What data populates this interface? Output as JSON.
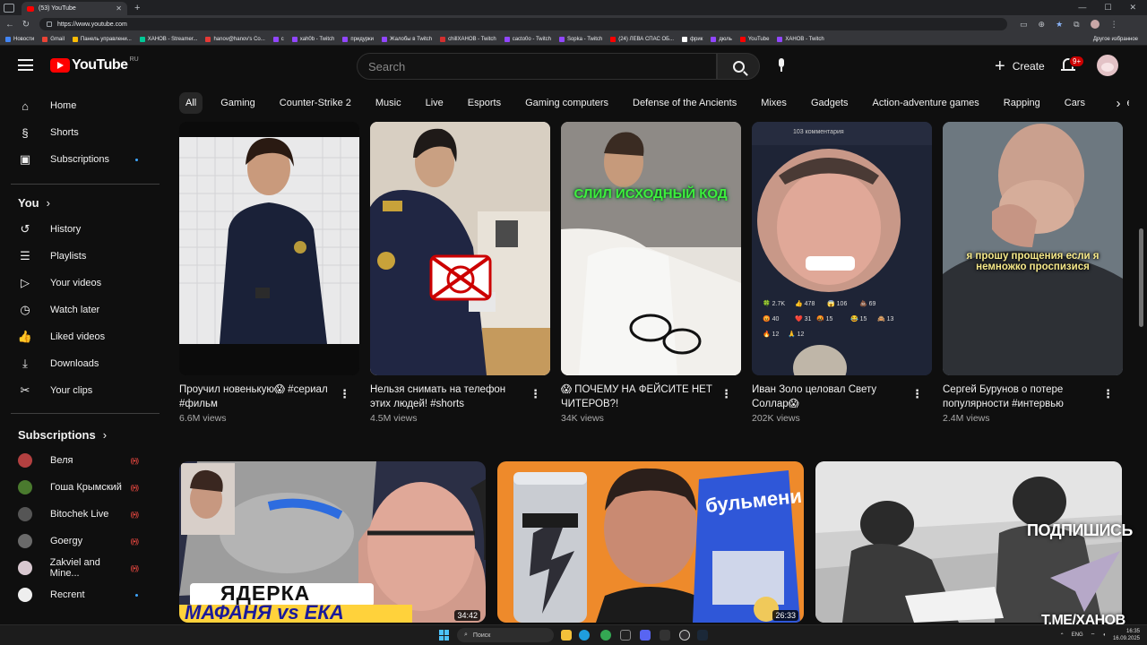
{
  "browser": {
    "tab_title": "(53) YouTube",
    "url": "https://www.youtube.com",
    "bookmarks": [
      {
        "label": "Новости",
        "color": "#4285f4"
      },
      {
        "label": "Gmail",
        "color": "#ea4335"
      },
      {
        "label": "Панель управлени...",
        "color": "#fbbc05"
      },
      {
        "label": "XAHOB - Streamer...",
        "color": "#00c896"
      },
      {
        "label": "hanov@hanov's Co...",
        "color": "#e53935"
      },
      {
        "label": "с",
        "color": "#9146ff"
      },
      {
        "label": "xah0b - Twitch",
        "color": "#9146ff"
      },
      {
        "label": "придурки",
        "color": "#9146ff"
      },
      {
        "label": "Жалобы в Twitch",
        "color": "#9146ff"
      },
      {
        "label": "chillXAHOB - Twitch",
        "color": "#d32f2f"
      },
      {
        "label": "cacto0o - Twitch",
        "color": "#9146ff"
      },
      {
        "label": "Sopka - Twitch",
        "color": "#9146ff"
      },
      {
        "label": "(24) ЛЕВА СПАС ОБ...",
        "color": "#ff0000"
      },
      {
        "label": "фрик",
        "color": "#ffffff"
      },
      {
        "label": "дюль",
        "color": "#9146ff"
      },
      {
        "label": "YouTube",
        "color": "#ff0000"
      },
      {
        "label": "XAHOB - Twitch",
        "color": "#9146ff"
      }
    ],
    "other_bookmarks": "Другое избранное"
  },
  "masthead": {
    "logo_text": "YouTube",
    "country_code": "RU",
    "search_placeholder": "Search",
    "create_label": "Create",
    "notification_count": "9+"
  },
  "sidebar": {
    "main": [
      {
        "label": "Home",
        "icon": "home-icon"
      },
      {
        "label": "Shorts",
        "icon": "shorts-icon"
      },
      {
        "label": "Subscriptions",
        "icon": "subscriptions-icon"
      }
    ],
    "you_heading": "You",
    "you": [
      {
        "label": "History",
        "icon": "history-icon"
      },
      {
        "label": "Playlists",
        "icon": "playlists-icon"
      },
      {
        "label": "Your videos",
        "icon": "your-videos-icon"
      },
      {
        "label": "Watch later",
        "icon": "watch-later-icon"
      },
      {
        "label": "Liked videos",
        "icon": "liked-videos-icon"
      },
      {
        "label": "Downloads",
        "icon": "downloads-icon"
      },
      {
        "label": "Your clips",
        "icon": "clips-icon"
      }
    ],
    "subs_heading": "Subscriptions",
    "subs": [
      {
        "label": "Веля",
        "status": "live",
        "color": "#b34040"
      },
      {
        "label": "Гоша Крымский",
        "status": "live",
        "color": "#4a7a2e"
      },
      {
        "label": "Bitochek Live",
        "status": "live",
        "color": "#555555"
      },
      {
        "label": "Goergy",
        "status": "live",
        "color": "#6a6a6a"
      },
      {
        "label": "Zakviel and Mine...",
        "status": "live",
        "color": "#d8c8d0"
      },
      {
        "label": "Recrent",
        "status": "dot",
        "color": "#eeeeee"
      }
    ]
  },
  "chips": [
    "All",
    "Gaming",
    "Counter-Strike 2",
    "Music",
    "Live",
    "Esports",
    "Gaming computers",
    "Defense of the Ancients",
    "Mixes",
    "Gadgets",
    "Action-adventure games",
    "Rapping",
    "Cars",
    "Rece"
  ],
  "shorts": [
    {
      "title": "Проучил новенькую😱 #сериал #фильм",
      "views": "6.6M views"
    },
    {
      "title": "Нельзя снимать на телефон этих людей! #shorts",
      "views": "4.5M views"
    },
    {
      "title": "😱 ПОЧЕМУ НА ФЕЙСИТЕ НЕТ ЧИТЕРОВ?!",
      "views": "34K views",
      "overlay": "СЛИЛ ИСХОДНЫЙ КОД"
    },
    {
      "title": "Иван Золо целовал Свету Соллар😱",
      "views": "202K views",
      "overlay": "103 комментария"
    },
    {
      "title": "Сергей Бурунов о потере популярности #интервью",
      "views": "2.4M views",
      "overlay": "я прошу прощения если я немножко проспизися"
    }
  ],
  "videos": [
    {
      "overlay_top": "ЯДЕРКА",
      "overlay_bottom": "МАФАНЯ vs ЕКА",
      "duration": "34:42"
    },
    {
      "overlay": "бульмени",
      "duration": "26:33"
    },
    {
      "duration": ""
    }
  ],
  "watermark": {
    "subscribe": "ПОДПИШИСЬ",
    "telegram": "T.ME/ХАНОВ"
  },
  "taskbar": {
    "search_placeholder": "Поиск",
    "lang": "ENG",
    "time": "16:35",
    "date": "16.09.2025"
  }
}
